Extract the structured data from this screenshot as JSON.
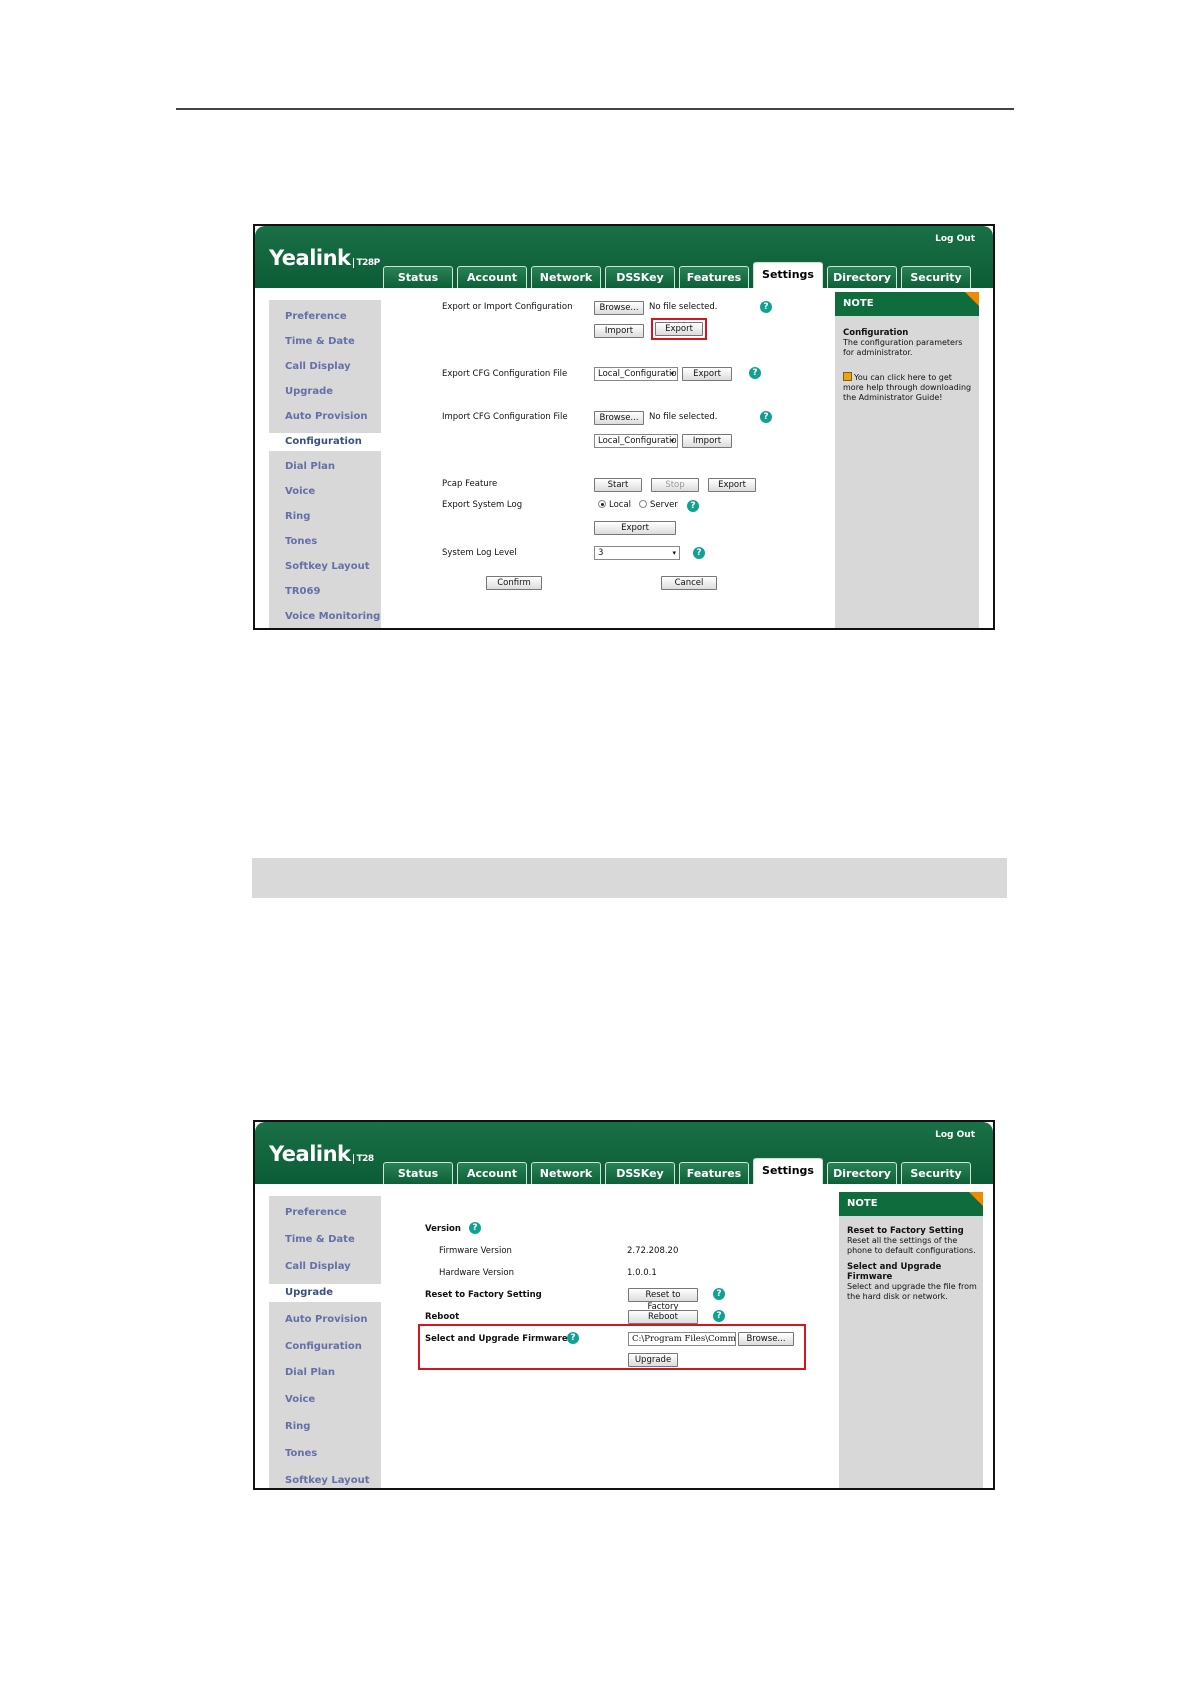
{
  "screenshot1": {
    "logo": "Yealink",
    "model": "T28P",
    "logout": "Log Out",
    "tabs": [
      "Status",
      "Account",
      "Network",
      "DSSKey",
      "Features",
      "Settings",
      "Directory",
      "Security"
    ],
    "active_tab": "Settings",
    "sidebar": [
      "Preference",
      "Time & Date",
      "Call Display",
      "Upgrade",
      "Auto Provision",
      "Configuration",
      "Dial Plan",
      "Voice",
      "Ring",
      "Tones",
      "Softkey Layout",
      "TR069",
      "Voice Monitoring"
    ],
    "active_sidebar": "Configuration",
    "form": {
      "export_import_label": "Export or Import Configuration",
      "browse": "Browse...",
      "no_file": "No file selected.",
      "import": "Import",
      "export": "Export",
      "export_cfg_label": "Export CFG Configuration File",
      "local_config": "Local_Configuratio",
      "import_cfg_label": "Import CFG Configuration File",
      "pcap_label": "Pcap Feature",
      "start": "Start",
      "stop": "Stop",
      "export_syslog_label": "Export System Log",
      "local": "Local",
      "server": "Server",
      "syslog_level_label": "System Log Level",
      "syslog_level": "3",
      "confirm": "Confirm",
      "cancel": "Cancel"
    },
    "note": {
      "title": "NOTE",
      "heading": "Configuration",
      "text": "The configuration parameters for administrator.",
      "help": "You can click here to get more help through downloading the Administrator Guide!"
    }
  },
  "screenshot2": {
    "logo": "Yealink",
    "model": "T28",
    "logout": "Log Out",
    "tabs": [
      "Status",
      "Account",
      "Network",
      "DSSKey",
      "Features",
      "Settings",
      "Directory",
      "Security"
    ],
    "active_tab": "Settings",
    "sidebar": [
      "Preference",
      "Time & Date",
      "Call Display",
      "Upgrade",
      "Auto Provision",
      "Configuration",
      "Dial Plan",
      "Voice",
      "Ring",
      "Tones",
      "Softkey Layout"
    ],
    "active_sidebar": "Upgrade",
    "form": {
      "version_label": "Version",
      "firmware_label": "Firmware Version",
      "firmware_value": "2.72.208.20",
      "hardware_label": "Hardware Version",
      "hardware_value": "1.0.0.1",
      "reset_label": "Reset to Factory Setting",
      "reset_button": "Reset to Factory",
      "reboot_label": "Reboot",
      "reboot_button": "Reboot",
      "upgrade_label": "Select and Upgrade Firmware",
      "file_path": "C:\\Program Files\\Comm",
      "browse": "Browse...",
      "upgrade_button": "Upgrade"
    },
    "note": {
      "title": "NOTE",
      "reset_heading": "Reset to Factory Setting",
      "reset_text": "Reset all the settings of the phone to default configurations.",
      "upgrade_heading": "Select and Upgrade Firmware",
      "upgrade_text": "Select and upgrade the file from the hard disk or network."
    }
  }
}
